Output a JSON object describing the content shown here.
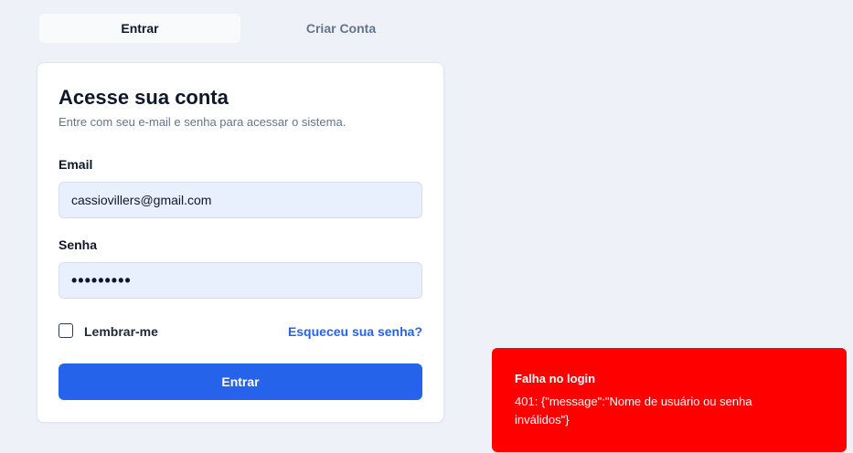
{
  "tabs": [
    {
      "label": "Entrar",
      "active": true
    },
    {
      "label": "Criar Conta",
      "active": false
    }
  ],
  "card": {
    "title": "Acesse sua conta",
    "subtitle": "Entre com seu e-mail e senha para acessar o sistema."
  },
  "form": {
    "email_label": "Email",
    "email_value": "cassiovillers@gmail.com",
    "password_label": "Senha",
    "password_value": "•••••••••",
    "remember_label": "Lembrar-me",
    "remember_checked": false,
    "forgot_label": "Esqueceu sua senha?",
    "submit_label": "Entrar"
  },
  "toast": {
    "title": "Falha no login",
    "message": "401: {\"message\":\"Nome de usuário ou senha inválidos\"}"
  },
  "colors": {
    "accent": "#2563eb",
    "error": "#ff0000",
    "input_bg": "#e8f0fe"
  }
}
